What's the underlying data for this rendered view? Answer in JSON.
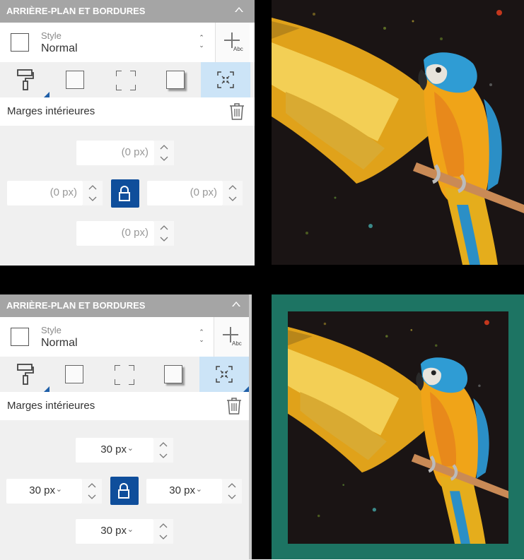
{
  "panel_header": "ARRIÈRE-PLAN ET BORDURES",
  "style": {
    "label": "Style",
    "value": "Normal",
    "add_icon_text": "Abc"
  },
  "tabs": [
    "background-tab",
    "border-tab",
    "dashed-border-tab",
    "shadow-tab",
    "padding-tab"
  ],
  "section_label": "Marges intérieures",
  "top_panel": {
    "top_value": "(0 px)",
    "left_value": "(0 px)",
    "right_value": "(0 px)",
    "bottom_value": "(0 px)"
  },
  "bottom_panel": {
    "top_value": "30 px",
    "left_value": "30 px",
    "right_value": "30 px",
    "bottom_value": "30 px"
  },
  "colors": {
    "header_bg": "#a5a5a5",
    "active_tab": "#cce4f7",
    "lock_button": "#0f4e9b",
    "frame_color": "#1d7463"
  }
}
